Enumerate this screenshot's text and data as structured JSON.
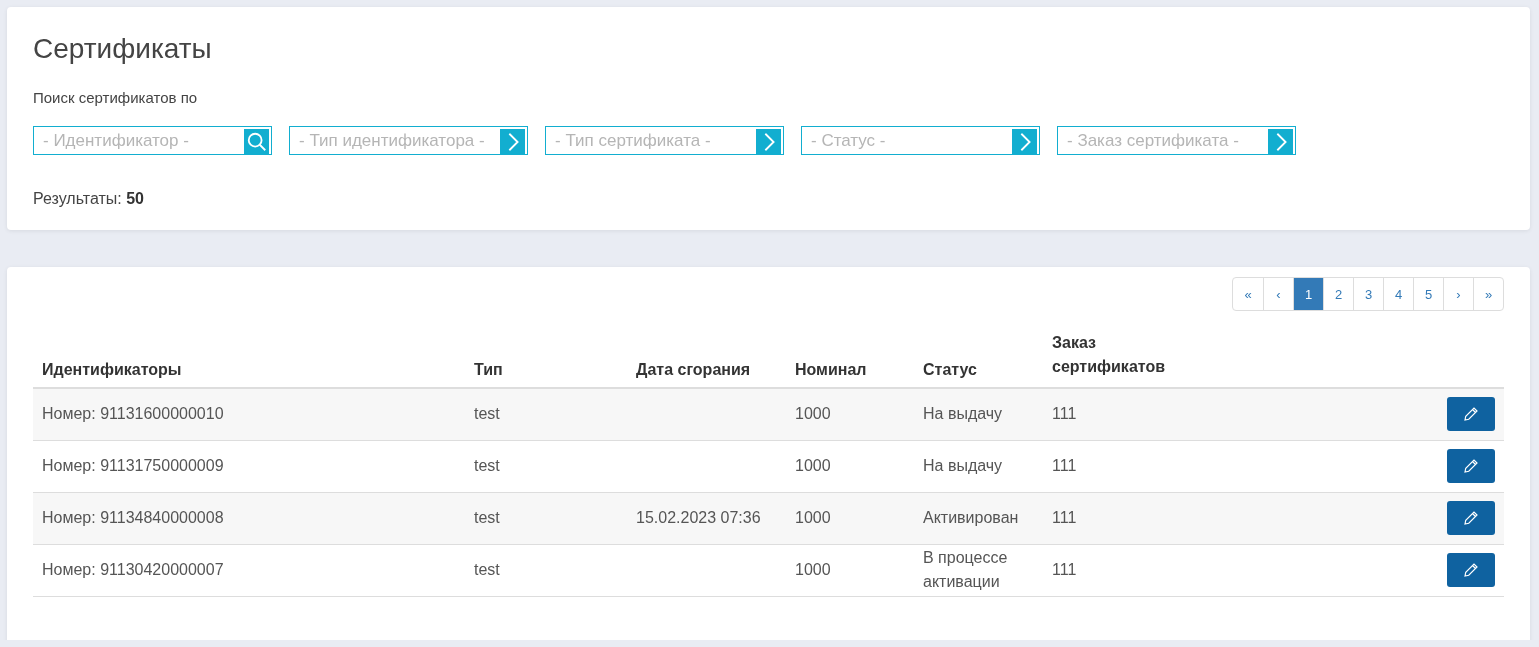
{
  "search_panel": {
    "title": "Сертификаты",
    "search_label": "Поиск сертификатов по",
    "filters": [
      {
        "kind": "search",
        "placeholder": "- Идентификатор -"
      },
      {
        "kind": "select",
        "placeholder": "- Тип идентификатора -"
      },
      {
        "kind": "select",
        "placeholder": "- Тип сертификата -"
      },
      {
        "kind": "select",
        "placeholder": "- Статус -"
      },
      {
        "kind": "select",
        "placeholder": "- Заказ сертификата -"
      }
    ],
    "results_label": "Результаты:",
    "results_count": "50"
  },
  "pagination": [
    {
      "label": "«",
      "selected": false
    },
    {
      "label": "‹",
      "selected": false
    },
    {
      "label": "1",
      "selected": true
    },
    {
      "label": "2",
      "selected": false
    },
    {
      "label": "3",
      "selected": false
    },
    {
      "label": "4",
      "selected": false
    },
    {
      "label": "5",
      "selected": false
    },
    {
      "label": "›",
      "selected": false
    },
    {
      "label": "»",
      "selected": false
    }
  ],
  "table": {
    "columns": [
      "Идентификаторы",
      "Тип",
      "Дата сгорания",
      "Номинал",
      "Статус",
      "Заказ сертификатов"
    ],
    "rows": [
      [
        "Номер: 91131600000010",
        "test",
        "",
        "1000",
        "На выдачу",
        "111"
      ],
      [
        "Номер: 91131750000009",
        "test",
        "",
        "1000",
        "На выдачу",
        "111"
      ],
      [
        "Номер: 91134840000008",
        "test",
        "15.02.2023 07:36",
        "1000",
        "Активирован",
        "111"
      ],
      [
        "Номер: 91130420000007",
        "test",
        "",
        "1000",
        "В процессе активации",
        "111"
      ]
    ]
  }
}
